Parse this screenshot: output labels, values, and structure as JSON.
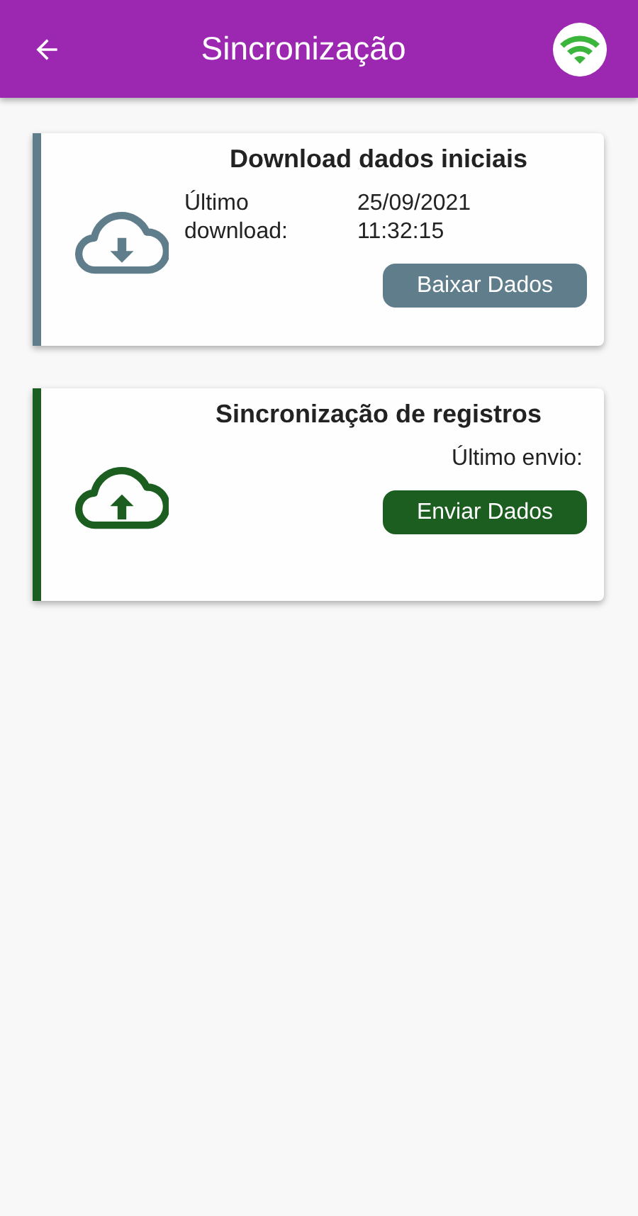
{
  "app_bar": {
    "title": "Sincronização"
  },
  "cards": [
    {
      "kind": "download",
      "color": "#607d8b",
      "title": "Download dados iniciais",
      "info": {
        "label": "Último download:",
        "value": "25/09/2021 11:32:15"
      },
      "button": "Baixar Dados"
    },
    {
      "kind": "upload",
      "color": "#1b5e20",
      "title": "Sincronização de registros",
      "info": {
        "label": "Último envio:"
      },
      "button": "Enviar Dados"
    }
  ]
}
